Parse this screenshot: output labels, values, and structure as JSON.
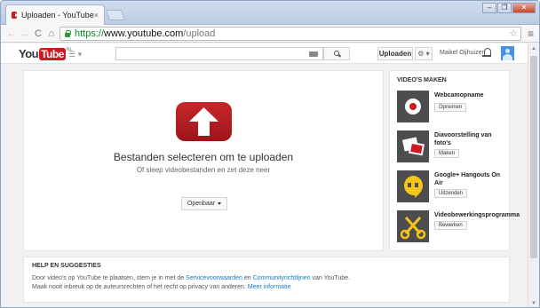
{
  "browser": {
    "tab_title": "Uploaden - YouTube",
    "tab_close": "×",
    "url_scheme": "https://",
    "url_host": "www.youtube.com",
    "url_path": "/upload",
    "window_controls": [
      "‒",
      "❐",
      "✕"
    ]
  },
  "masthead": {
    "logo_you": "You",
    "logo_tube": "Tube",
    "logo_country": "NL",
    "upload_label": "Uploaden",
    "username": "Maikel Oijhuizen",
    "icons": [
      "guide-icon",
      "keyboard-icon",
      "search-icon",
      "gear-icon",
      "bell-icon",
      "avatar"
    ]
  },
  "upload": {
    "title": "Bestanden selecteren om te uploaden",
    "subtitle": "Of sleep videobestanden en zet deze neer",
    "privacy_value": "Openbaar",
    "colors": {
      "arrow_red": "#c7262b"
    }
  },
  "side": {
    "heading": "VIDEO'S MAKEN",
    "tools": [
      {
        "name": "Webcamopname",
        "action": "Opnemen",
        "icon": "record-icon"
      },
      {
        "name": "Diavoorstelling van foto's",
        "action": "Maken",
        "icon": "slideshow-icon"
      },
      {
        "name": "Google+ Hangouts On Air",
        "action": "Uitzenden",
        "icon": "hangouts-icon"
      },
      {
        "name": "Videobewerkingsprogramma",
        "action": "Bewerken",
        "icon": "scissors-icon"
      }
    ]
  },
  "help": {
    "heading": "HELP EN SUGGESTIES",
    "line1_a": "Door video's op YouTube te plaatsen, stem je in met de ",
    "line1_link1": "Servicevoorwaarden",
    "line1_b": " en ",
    "line1_link2": "Communityrichtlijnen",
    "line1_c": " van YouTube.",
    "line2_a": "Maak nooit inbreuk op de auteursrechten of het recht op privacy van anderen. ",
    "line2_link": "Meer informatie"
  }
}
